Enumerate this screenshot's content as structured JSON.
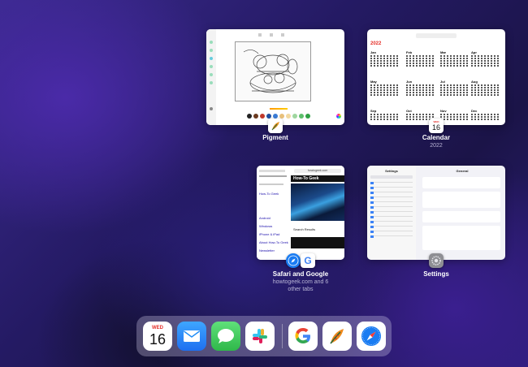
{
  "app_switcher": {
    "cards": [
      {
        "app": "Pigment",
        "subtitle": ""
      },
      {
        "app": "Calendar",
        "subtitle": "2022",
        "calendar": {
          "year": "2022",
          "today_weekday": "WED",
          "today_day": "16",
          "months": [
            "Jan",
            "Feb",
            "Mar",
            "Apr",
            "May",
            "Jun",
            "Jul",
            "Aug",
            "Sep",
            "Oct",
            "Nov",
            "Dec"
          ]
        }
      },
      {
        "app": "Safari and Google",
        "subtitle_line1": "howtogeek.com and 6",
        "subtitle_line2": "other tabs",
        "safari": {
          "url": "howtogeek.com",
          "site_name": "How-To Geek",
          "search_results": "Search Results",
          "links": [
            "How-To Geek",
            "Android",
            "Windows",
            "iPhone & iPad",
            "About How-To Geek",
            "Newsletter"
          ]
        }
      },
      {
        "app": "Settings",
        "subtitle": "",
        "settings": {
          "sidebar_title": "Settings",
          "pane_title": "General"
        }
      }
    ]
  },
  "dock": {
    "calendar_weekday": "WED",
    "calendar_day": "16",
    "apps": [
      "Calendar",
      "Mail",
      "Messages",
      "Slack",
      "Google",
      "Pigment",
      "Safari"
    ]
  },
  "colors": {
    "calendar_red": "#e5312b",
    "mail_blue": "#1e8cf7",
    "messages_green": "#34c759",
    "safari_blue": "#1a7cf2"
  }
}
